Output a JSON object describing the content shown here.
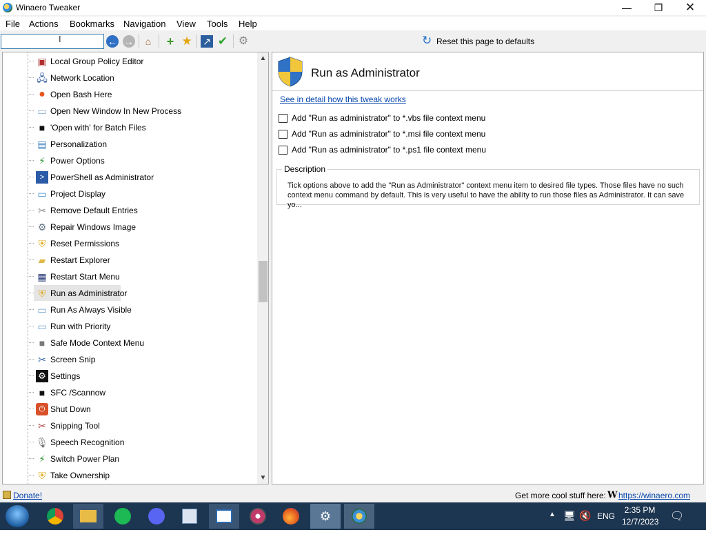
{
  "window": {
    "title": "Winaero Tweaker",
    "controls": {
      "minimize": "—",
      "maximize": "❐",
      "close": "✕"
    }
  },
  "menu": [
    "File",
    "Actions",
    "Bookmarks",
    "Navigation",
    "View",
    "Tools",
    "Help"
  ],
  "toolbar": {
    "search_value": "",
    "reset_label": "Reset this page to defaults"
  },
  "tree": {
    "items": [
      {
        "label": "Local Group Policy Editor",
        "icon": "policy-icon"
      },
      {
        "label": "Network Location",
        "icon": "network-icon"
      },
      {
        "label": "Open Bash Here",
        "icon": "ubuntu-icon"
      },
      {
        "label": "Open New Window In New Process",
        "icon": "window-icon"
      },
      {
        "label": "'Open with' for Batch Files",
        "icon": "console-icon"
      },
      {
        "label": "Personalization",
        "icon": "personalization-icon"
      },
      {
        "label": "Power Options",
        "icon": "power-options-icon"
      },
      {
        "label": "PowerShell as Administrator",
        "icon": "powershell-icon"
      },
      {
        "label": "Project Display",
        "icon": "display-icon"
      },
      {
        "label": "Remove Default Entries",
        "icon": "remove-icon"
      },
      {
        "label": "Repair Windows Image",
        "icon": "repair-icon"
      },
      {
        "label": "Reset Permissions",
        "icon": "shield-icon"
      },
      {
        "label": "Restart Explorer",
        "icon": "folder-icon"
      },
      {
        "label": "Restart Start Menu",
        "icon": "start-menu-icon"
      },
      {
        "label": "Run as Administrator",
        "icon": "shield-icon"
      },
      {
        "label": "Run As Always Visible",
        "icon": "run-icon"
      },
      {
        "label": "Run with Priority",
        "icon": "priority-icon"
      },
      {
        "label": "Safe Mode Context Menu",
        "icon": "safe-mode-icon"
      },
      {
        "label": "Screen Snip",
        "icon": "scissors-icon"
      },
      {
        "label": "Settings",
        "icon": "gear-icon"
      },
      {
        "label": "SFC /Scannow",
        "icon": "console-icon"
      },
      {
        "label": "Shut Down",
        "icon": "shutdown-icon"
      },
      {
        "label": "Snipping Tool",
        "icon": "snipping-tool-icon"
      },
      {
        "label": "Speech Recognition",
        "icon": "microphone-icon"
      },
      {
        "label": "Switch Power Plan",
        "icon": "power-plan-icon"
      },
      {
        "label": "Take Ownership",
        "icon": "shield-icon"
      }
    ],
    "selected": "Run as Administrator"
  },
  "content": {
    "title": "Run as Administrator",
    "detail_link": "See in detail how this tweak works",
    "options": [
      {
        "label": "Add \"Run as administrator\" to *.vbs file context menu",
        "checked": false
      },
      {
        "label": "Add \"Run as administrator\" to *.msi file context menu",
        "checked": false
      },
      {
        "label": "Add \"Run as administrator\" to *.ps1 file context menu",
        "checked": false
      }
    ],
    "description_title": "Description",
    "description_text": "Tick options above to add the \"Run as Administrator\" context menu item to desired file types. Those files have no such context menu command by default. This is very useful to have the ability to run those files as Administrator. It can save yo..."
  },
  "status": {
    "donate": "Donate!",
    "more_text": "Get more cool stuff here:",
    "site_letter": "W",
    "site_link": "https://winaero.com"
  },
  "taskbar": {
    "apps": [
      "start-button",
      "chrome-icon",
      "file-explorer-icon",
      "spotify-icon",
      "discord-icon",
      "app-icon",
      "remote-desktop-icon",
      "media-icon",
      "firefox-icon",
      "settings-icon",
      "winaero-tweaker-icon"
    ],
    "language": "ENG",
    "time": "2:35 PM",
    "date": "12/7/2023"
  }
}
